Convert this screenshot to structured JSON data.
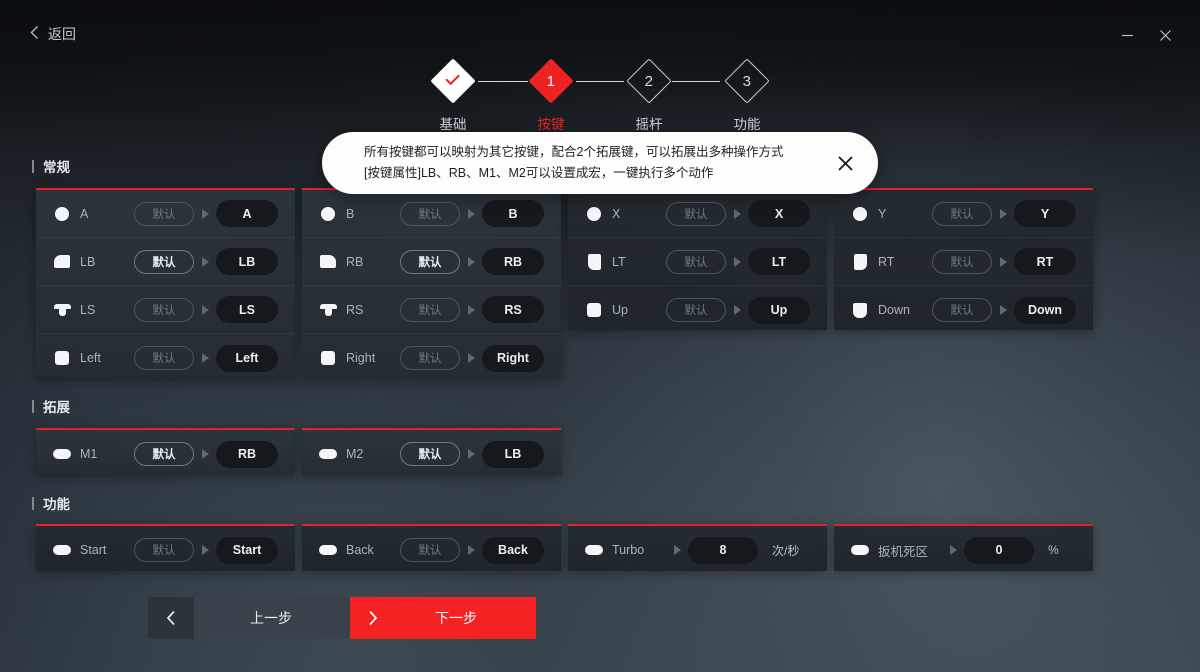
{
  "titlebar": {
    "back_label": "返回",
    "back_icon": "chevron-left-icon",
    "minimize_icon": "minimize-icon",
    "close_icon": "close-icon"
  },
  "stepper": {
    "steps": [
      {
        "label": "基础",
        "marker": "✓",
        "state": "done"
      },
      {
        "label": "按键",
        "marker": "1",
        "state": "active"
      },
      {
        "label": "摇杆",
        "marker": "2",
        "state": "todo"
      },
      {
        "label": "功能",
        "marker": "3",
        "state": "todo"
      }
    ]
  },
  "tooltip": {
    "line1": "所有按键都可以映射为其它按键，配合2个拓展键，可以拓展出多种操作方式",
    "line2": "[按键属性]LB、RB、M1、M2可以设置成宏，一键执行多个动作",
    "close_icon": "close-icon"
  },
  "sections": {
    "general": {
      "title": "常规"
    },
    "extension": {
      "title": "拓展"
    },
    "function": {
      "title": "功能"
    }
  },
  "default_label": "默认",
  "panels": {
    "general": [
      {
        "rows": [
          {
            "icon": "button-a-icon",
            "label": "A",
            "default": "默认",
            "default_highlighted": false,
            "value": "A"
          },
          {
            "icon": "bumper-lb-icon",
            "label": "LB",
            "default": "默认",
            "default_highlighted": true,
            "value": "LB"
          },
          {
            "icon": "stick-ls-icon",
            "label": "LS",
            "default": "默认",
            "default_highlighted": false,
            "value": "LS"
          },
          {
            "icon": "dpad-left-icon",
            "label": "Left",
            "default": "默认",
            "default_highlighted": false,
            "value": "Left"
          }
        ]
      },
      {
        "rows": [
          {
            "icon": "button-b-icon",
            "label": "B",
            "default": "默认",
            "default_highlighted": false,
            "value": "B"
          },
          {
            "icon": "bumper-rb-icon",
            "label": "RB",
            "default": "默认",
            "default_highlighted": true,
            "value": "RB"
          },
          {
            "icon": "stick-rs-icon",
            "label": "RS",
            "default": "默认",
            "default_highlighted": false,
            "value": "RS"
          },
          {
            "icon": "dpad-right-icon",
            "label": "Right",
            "default": "默认",
            "default_highlighted": false,
            "value": "Right"
          }
        ]
      },
      {
        "rows": [
          {
            "icon": "button-x-icon",
            "label": "X",
            "default": "默认",
            "default_highlighted": false,
            "value": "X"
          },
          {
            "icon": "trigger-lt-icon",
            "label": "LT",
            "default": "默认",
            "default_highlighted": false,
            "value": "LT"
          },
          {
            "icon": "dpad-up-icon",
            "label": "Up",
            "default": "默认",
            "default_highlighted": false,
            "value": "Up"
          }
        ]
      },
      {
        "rows": [
          {
            "icon": "button-y-icon",
            "label": "Y",
            "default": "默认",
            "default_highlighted": false,
            "value": "Y"
          },
          {
            "icon": "trigger-rt-icon",
            "label": "RT",
            "default": "默认",
            "default_highlighted": false,
            "value": "RT"
          },
          {
            "icon": "dpad-down-icon",
            "label": "Down",
            "default": "默认",
            "default_highlighted": false,
            "value": "Down"
          }
        ]
      }
    ],
    "extension": [
      {
        "icon": "m1-key-icon",
        "label": "M1",
        "default": "默认",
        "default_highlighted": true,
        "value": "RB"
      },
      {
        "icon": "m2-key-icon",
        "label": "M2",
        "default": "默认",
        "default_highlighted": true,
        "value": "LB"
      }
    ],
    "function": [
      {
        "icon": "start-key-icon",
        "label": "Start",
        "default": "默认",
        "default_highlighted": false,
        "value": "Start"
      },
      {
        "icon": "back-key-icon",
        "label": "Back",
        "default": "默认",
        "default_highlighted": false,
        "value": "Back"
      }
    ],
    "numeric": [
      {
        "icon": "turbo-icon",
        "label": "Turbo",
        "value": "8",
        "unit": "次/秒"
      },
      {
        "icon": "trigger-dead-icon",
        "label": "扳机死区",
        "value": "0",
        "unit": "%"
      }
    ]
  },
  "footer": {
    "prev_label": "上一步",
    "prev_icon": "chevron-left-icon",
    "next_label": "下一步",
    "next_icon": "chevron-right-icon"
  },
  "colors": {
    "accent_red": "#ef2222",
    "panel_rule_red": "#e1222b",
    "next_button": "#f42222"
  }
}
